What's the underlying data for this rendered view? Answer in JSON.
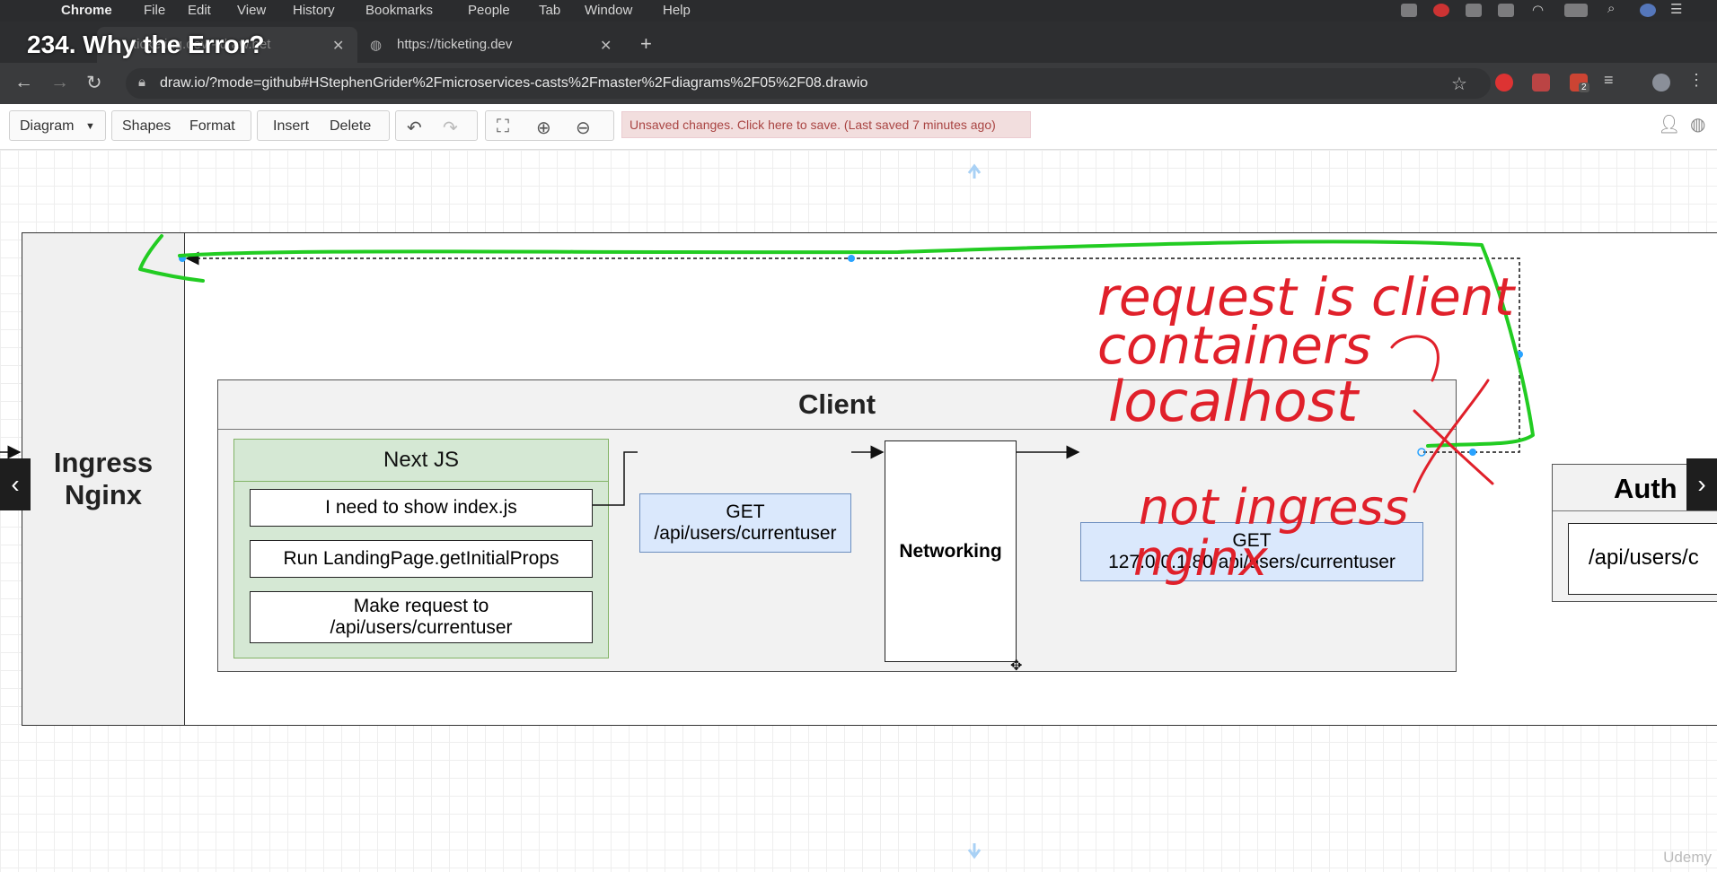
{
  "menubar": {
    "app": "Chrome",
    "items": [
      "File",
      "Edit",
      "View",
      "History",
      "Bookmarks",
      "People",
      "Tab",
      "Window",
      "Help"
    ]
  },
  "video_title": "234. Why the Error?",
  "tabs": [
    {
      "label": "ticketing.dev - draw.net",
      "active": true
    },
    {
      "label": "https://ticketing.dev",
      "active": false
    }
  ],
  "address": {
    "url": "draw.io/?mode=github#HStephenGrider%2Fmicroservices-casts%2Fmaster%2Fdiagrams%2F05%2F08.drawio",
    "extension_badge": "2"
  },
  "toolbar": {
    "diagram": "Diagram",
    "shapes": "Shapes",
    "format": "Format",
    "insert": "Insert",
    "delete": "Delete",
    "unsaved": "Unsaved changes. Click here to save. (Last saved 7 minutes ago)"
  },
  "diagram": {
    "ingress_label": "Ingress\nNginx",
    "client_title": "Client",
    "nextjs_title": "Next JS",
    "step1": "I need to show index.js",
    "step2": "Run LandingPage.getInitialProps",
    "step3": "Make request to\n/api/users/currentuser",
    "get1": "GET\n/api/users/currentuser",
    "networking": "Networking",
    "get2": "GET\n127.0.0.1:80/api/users/currentuser",
    "auth_title": "Auth",
    "auth_route": "/api/users/c"
  },
  "annotations": {
    "line1": "request is client",
    "line2": "containers",
    "line3": "localhost",
    "line4": "not ingress",
    "line5": "nginx"
  },
  "watermark": "Udemy",
  "colors": {
    "annotation_red": "#e0202a",
    "annotation_green": "#22cc22",
    "nextjs_fill": "#d5e8d4",
    "nextjs_border": "#82b366",
    "get_fill": "#dae8fc",
    "get_border": "#6c8ebf",
    "selection_blue": "#29a3ff"
  }
}
